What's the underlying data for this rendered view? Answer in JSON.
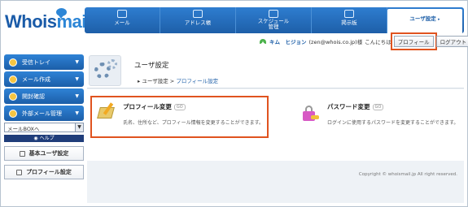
{
  "logo": {
    "part1": "Whois",
    "part2": "mail"
  },
  "topnav": [
    {
      "label": "メール",
      "active": false
    },
    {
      "label": "アドレス帳",
      "active": false
    },
    {
      "label": "スケジュール\n管理",
      "active": false
    },
    {
      "label": "掲示板",
      "active": false
    },
    {
      "label": "ユーザ設定",
      "active": true
    }
  ],
  "userbar": {
    "name": "キム　ヒジョン",
    "email": "(zen@whois.co.jp)様",
    "greeting": "こんにちは",
    "profile_button": "プロフィール",
    "logout_button": "ログアウト"
  },
  "sidebar": {
    "items": [
      {
        "label": "受信トレイ"
      },
      {
        "label": "メール作成"
      },
      {
        "label": "開封確認"
      },
      {
        "label": "外部メール管理"
      }
    ],
    "select_value": "メールBOXへ",
    "help": "ヘルプ",
    "basic_settings": "基本ユーザ設定",
    "profile_settings": "プロフィール設定"
  },
  "page": {
    "title": "ユーザ設定",
    "breadcrumb_parent": "ユーザ設定",
    "breadcrumb_sep": " > ",
    "breadcrumb_current": "プロフィール設定"
  },
  "cards": {
    "profile": {
      "title": "プロフィール変更",
      "go": "GO",
      "desc": "氏名、住所など、プロフィール情報を変更することができます。"
    },
    "password": {
      "title": "パスワード変更",
      "go": "GO",
      "desc": "ログインに使用するパスワードを変更することができます。"
    }
  },
  "footer": {
    "copyright": "Copyright © whoismail.jp All right reserved."
  }
}
